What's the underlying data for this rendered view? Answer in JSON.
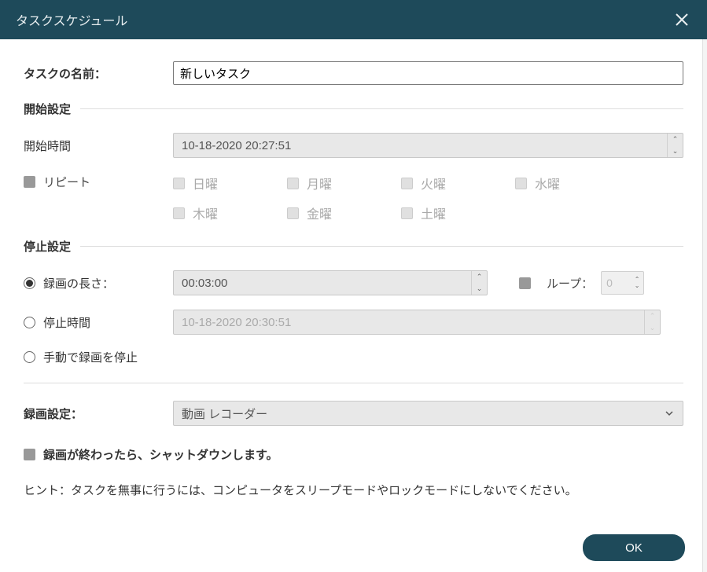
{
  "titlebar": {
    "title": "タスクスケジュール"
  },
  "taskName": {
    "label": "タスクの名前：",
    "value": "新しいタスク"
  },
  "startSettings": {
    "header": "開始設定",
    "startTimeLabel": "開始時間",
    "startTimeValue": "10-18-2020 20:27:51",
    "repeatLabel": "リピート",
    "days": {
      "sun": "日曜",
      "mon": "月曜",
      "tue": "火曜",
      "wed": "水曜",
      "thu": "木曜",
      "fri": "金曜",
      "sat": "土曜"
    }
  },
  "stopSettings": {
    "header": "停止設定",
    "durationLabel": "録画の長さ：",
    "durationValue": "00:03:00",
    "loopLabel": "ループ：",
    "loopValue": "0",
    "stopTimeLabel": "停止時間",
    "stopTimeValue": "10-18-2020 20:30:51",
    "manualLabel": "手動で録画を停止"
  },
  "recordSettings": {
    "label": "録画設定：",
    "selected": "動画 レコーダー"
  },
  "shutdown": {
    "label": "録画が終わったら、シャットダウンします。"
  },
  "hint": "ヒント：タスクを無事に行うには、コンピュータをスリープモードやロックモードにしないでください。",
  "footer": {
    "okLabel": "OK"
  }
}
